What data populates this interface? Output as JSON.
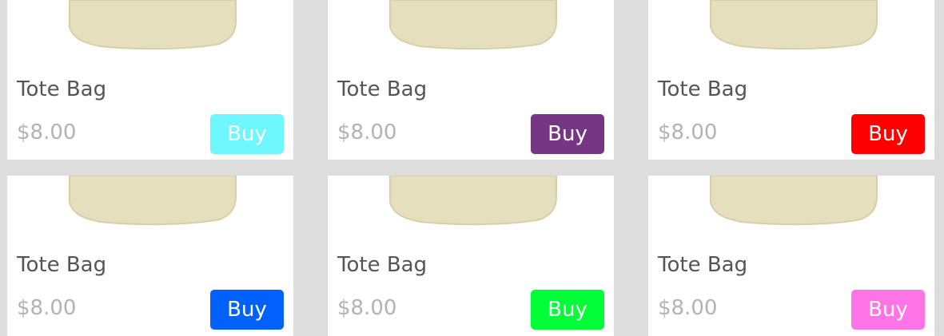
{
  "products": [
    {
      "title": "Tote Bag",
      "price": "$8.00",
      "buy_label": "Buy",
      "button_color": "#6ff7ff"
    },
    {
      "title": "Tote Bag",
      "price": "$8.00",
      "buy_label": "Buy",
      "button_color": "#763683"
    },
    {
      "title": "Tote Bag",
      "price": "$8.00",
      "buy_label": "Buy",
      "button_color": "#ff0000"
    },
    {
      "title": "Tote Bag",
      "price": "$8.00",
      "buy_label": "Buy",
      "button_color": "#0061fd"
    },
    {
      "title": "Tote Bag",
      "price": "$8.00",
      "buy_label": "Buy",
      "button_color": "#00ff36"
    },
    {
      "title": "Tote Bag",
      "price": "$8.00",
      "buy_label": "Buy",
      "button_color": "#ff74e6"
    }
  ],
  "colors": {
    "gutter": "#dddddd",
    "card_background": "#ffffff",
    "title_text": "#555555",
    "price_text": "#b3b3b3",
    "bag_fabric": "#e6dfbd"
  }
}
